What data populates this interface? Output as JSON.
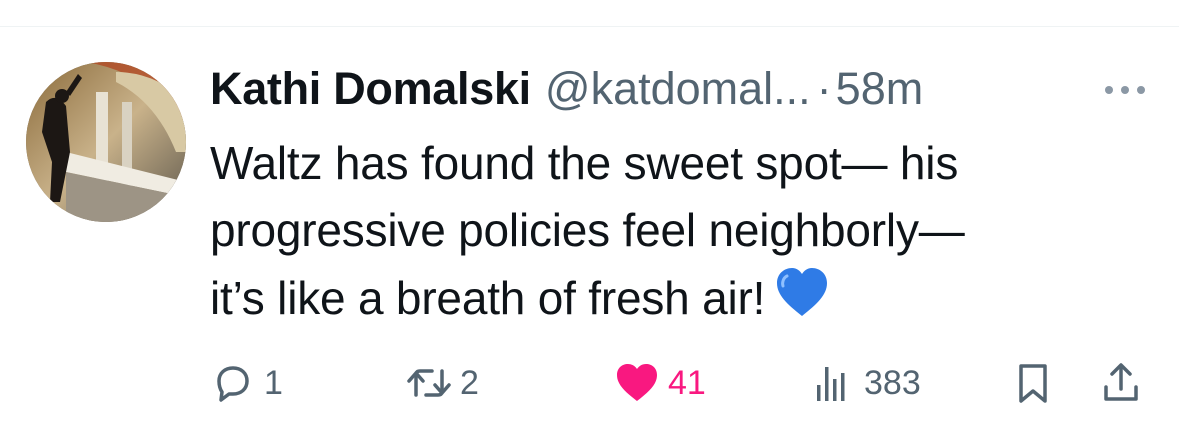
{
  "tweet": {
    "author": {
      "display_name": "Kathi Domalski",
      "handle": "@katdomal...",
      "avatar_icon": "avatar-photo"
    },
    "separator": "·",
    "time": "58m",
    "text_lines": [
      "Waltz has found the sweet spot— his",
      "progressive policies feel neighborly—",
      "it’s like a breath of fresh air!"
    ],
    "emoji": "blue-heart-emoji",
    "actions": {
      "reply": {
        "icon": "reply-icon",
        "count": "1"
      },
      "retweet": {
        "icon": "retweet-icon",
        "count": "2"
      },
      "like": {
        "icon": "heart-filled-icon",
        "count": "41",
        "color": "#f91880"
      },
      "views": {
        "icon": "views-icon",
        "count": "383"
      },
      "bookmark": {
        "icon": "bookmark-icon"
      },
      "share": {
        "icon": "share-icon"
      }
    }
  },
  "colors": {
    "primary_text": "#0f1419",
    "secondary_text": "#536471",
    "like_pink": "#f91880",
    "emoji_blue": "#2f7be6"
  }
}
